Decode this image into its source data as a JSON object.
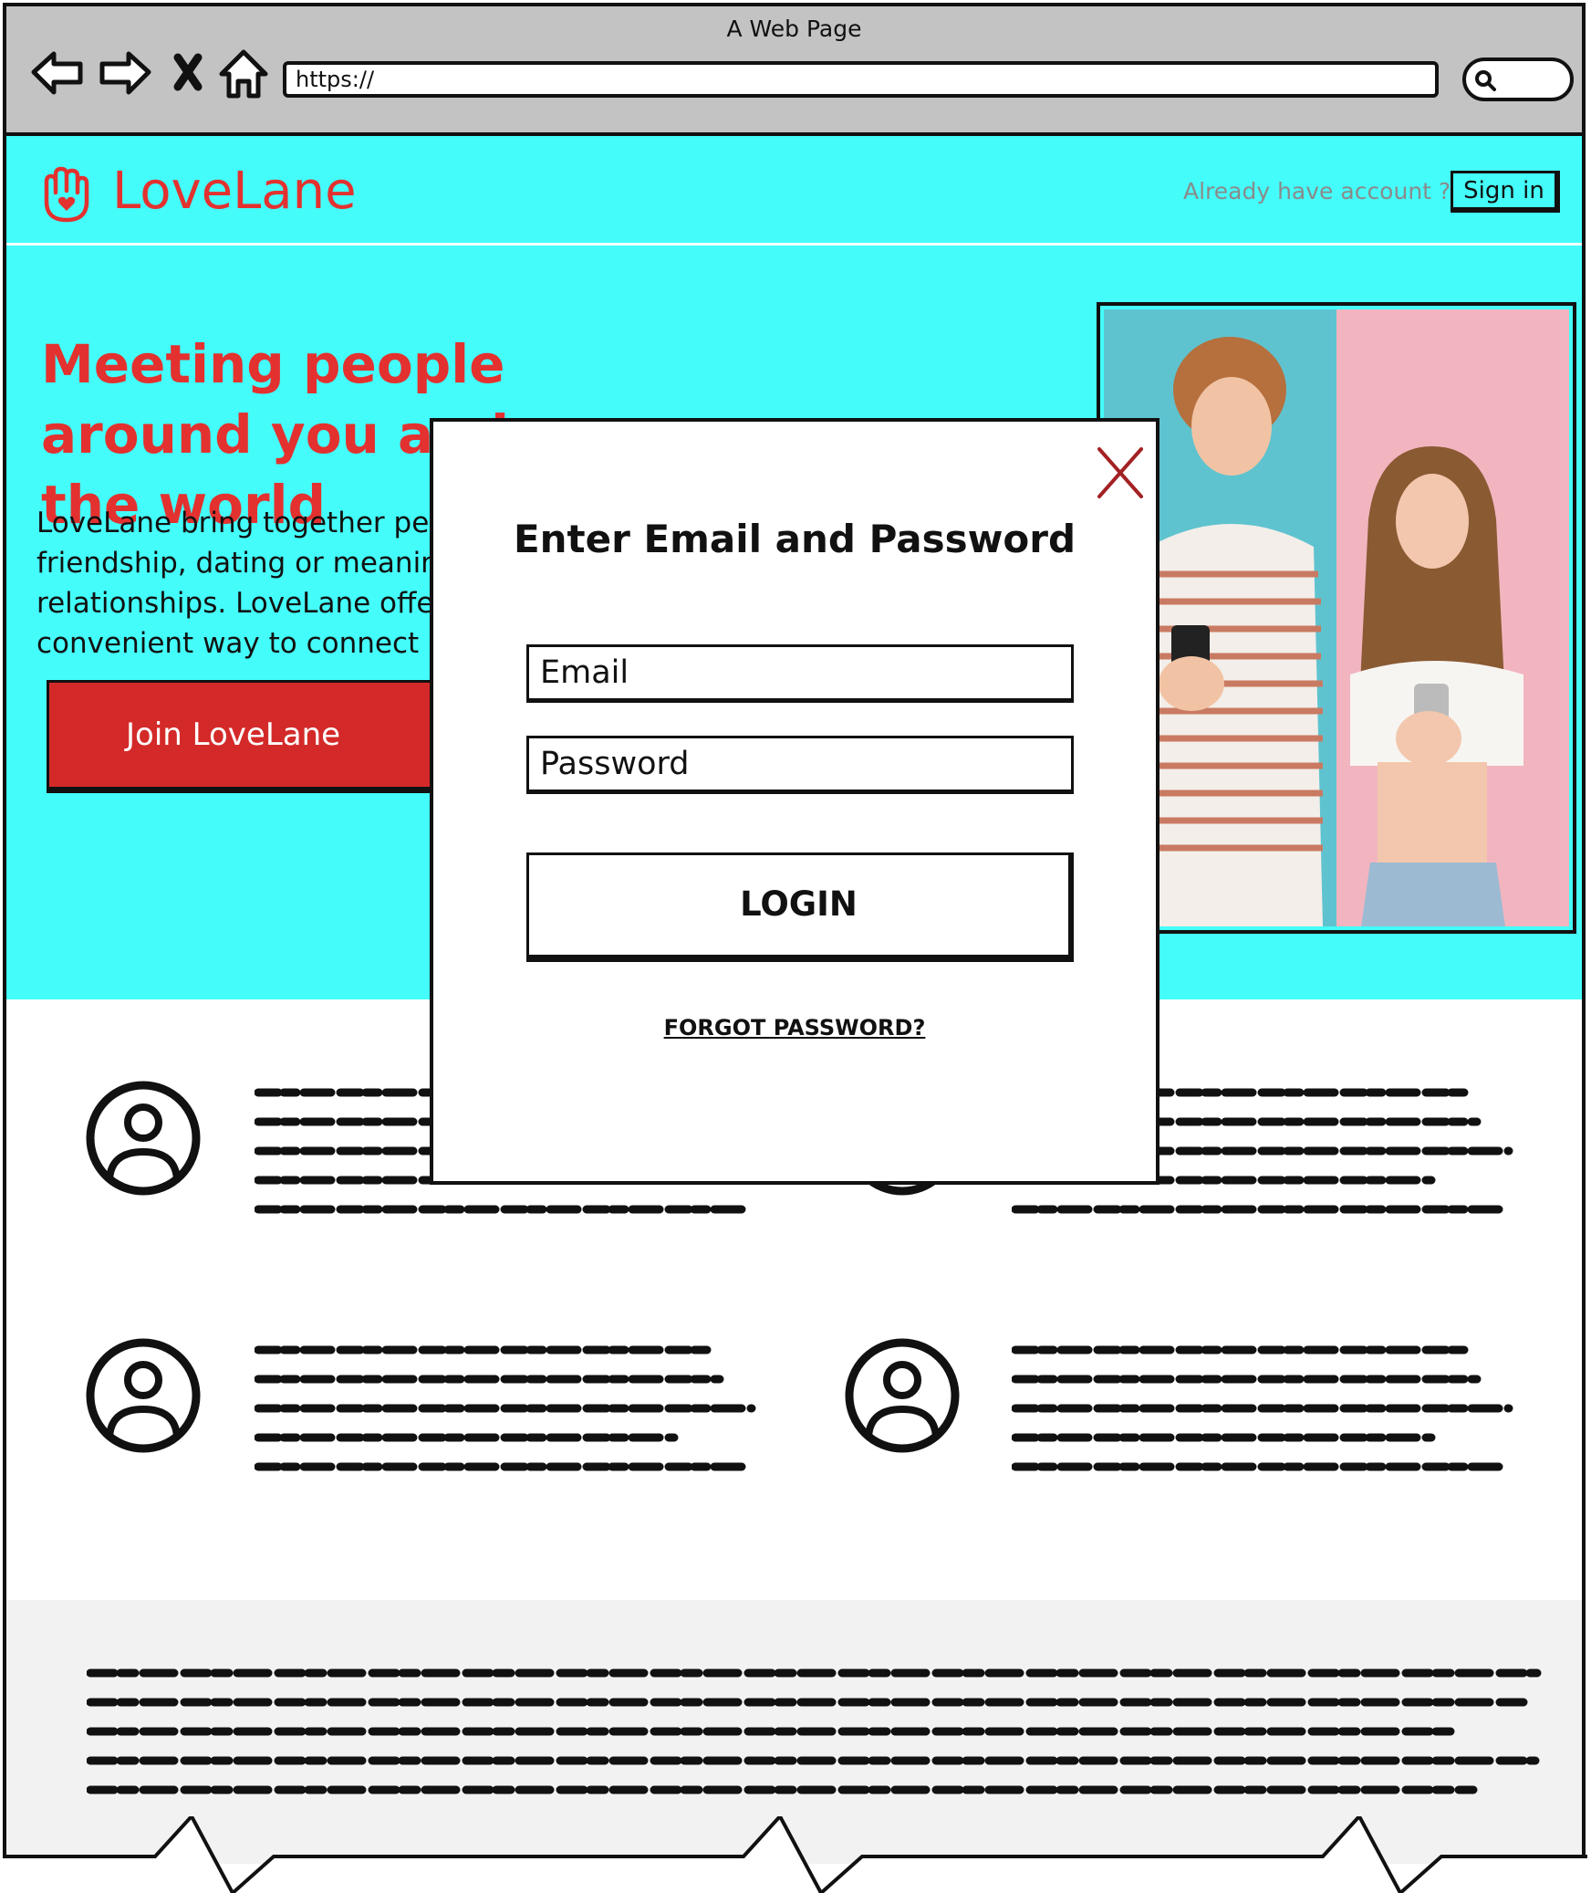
{
  "browser": {
    "window_title": "A Web Page",
    "url": "https://",
    "icons": [
      "back-arrow-icon",
      "forward-arrow-icon",
      "close-x-icon",
      "home-icon",
      "search-icon"
    ]
  },
  "header": {
    "brand": "LoveLane",
    "logo_icon": "raised-hand-heart-icon",
    "account_prompt": "Already have account ?",
    "signin_label": "Sign in"
  },
  "hero": {
    "title": "Meeting people around you and over the world",
    "description": "LoveLane bring together people for friendship, dating or meaningful relationships. LoveLane offers a convenient way to connect",
    "join_label": "Join LoveLane",
    "photo_icon": "couple-with-phones-photo"
  },
  "features": {
    "avatar_icon": "user-circle-icon",
    "count": 4
  },
  "login_modal": {
    "title": "Enter Email and Password",
    "email_placeholder": "Email",
    "password_placeholder": "Password",
    "login_label": "LOGIN",
    "forgot_label": "FORGOT PASSWORD?",
    "close_icon": "close-x-icon"
  },
  "colors": {
    "cyan": "#44fdfa",
    "brand_red": "#e3312f",
    "button_red": "#d32a29",
    "chrome_gray": "#c3c3c3",
    "footer_gray": "#f2f2f2"
  }
}
